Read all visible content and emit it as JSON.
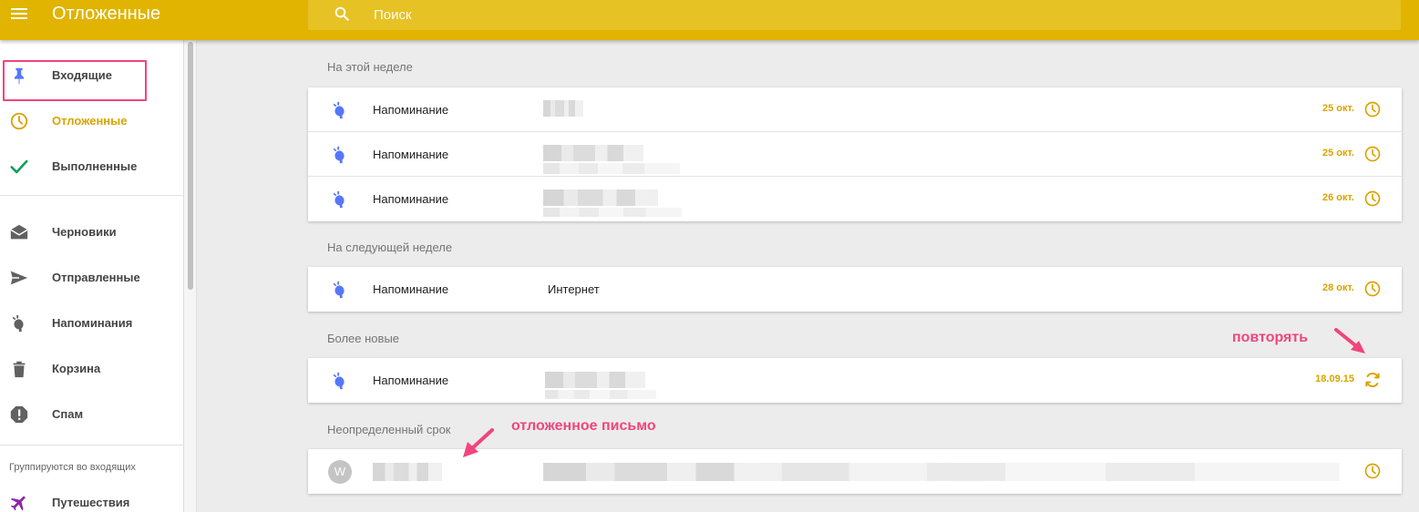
{
  "header": {
    "menu_icon": "hamburger-menu-icon",
    "title": "Отложенные",
    "search_icon": "search-icon",
    "search_placeholder": "Поиск",
    "bar_color": "#e0b400"
  },
  "sidebar": {
    "items": [
      {
        "label": "Входящие",
        "icon": "pin-icon"
      },
      {
        "label": "Отложенные",
        "icon": "clock-icon",
        "active": true
      },
      {
        "label": "Выполненные",
        "icon": "checkmark-icon"
      },
      {
        "label": "Черновики",
        "icon": "drafts-icon"
      },
      {
        "label": "Отправленные",
        "icon": "send-icon"
      },
      {
        "label": "Напоминания",
        "icon": "reminder-icon"
      },
      {
        "label": "Корзина",
        "icon": "trash-icon"
      },
      {
        "label": "Спам",
        "icon": "spam-icon"
      }
    ],
    "group_title": "Группируются во входящих",
    "group_items": [
      {
        "label": "Путешествия",
        "icon": "airplane-icon"
      }
    ]
  },
  "sections": [
    {
      "title": "На этой неделе",
      "rows": [
        {
          "title": "Напоминание",
          "subject": "",
          "date": "25 окт.",
          "action_icon": "clock-icon"
        },
        {
          "title": "Напоминание",
          "subject": "",
          "date": "25 окт.",
          "action_icon": "clock-icon"
        },
        {
          "title": "Напоминание",
          "subject": "",
          "date": "26 окт.",
          "action_icon": "clock-icon"
        }
      ]
    },
    {
      "title": "На следующей неделе",
      "rows": [
        {
          "title": "Напоминание",
          "subject": "Интернет",
          "date": "28 окт.",
          "action_icon": "clock-icon"
        }
      ]
    },
    {
      "title": "Более новые",
      "rows": [
        {
          "title": "Напоминание",
          "subject": "",
          "date": "18.09.15",
          "action_icon": "repeat-icon"
        }
      ]
    },
    {
      "title": "Неопределенный срок",
      "rows": [
        {
          "avatar_letter": "W",
          "action_icon": "clock-icon"
        }
      ]
    }
  ],
  "annotations": {
    "repeat": "повторять",
    "snoozed_letter": "отложенное письмо",
    "color": "#f0457d"
  },
  "colors": {
    "accent": "#d9a300",
    "reminder_icon": "#5677fc"
  }
}
